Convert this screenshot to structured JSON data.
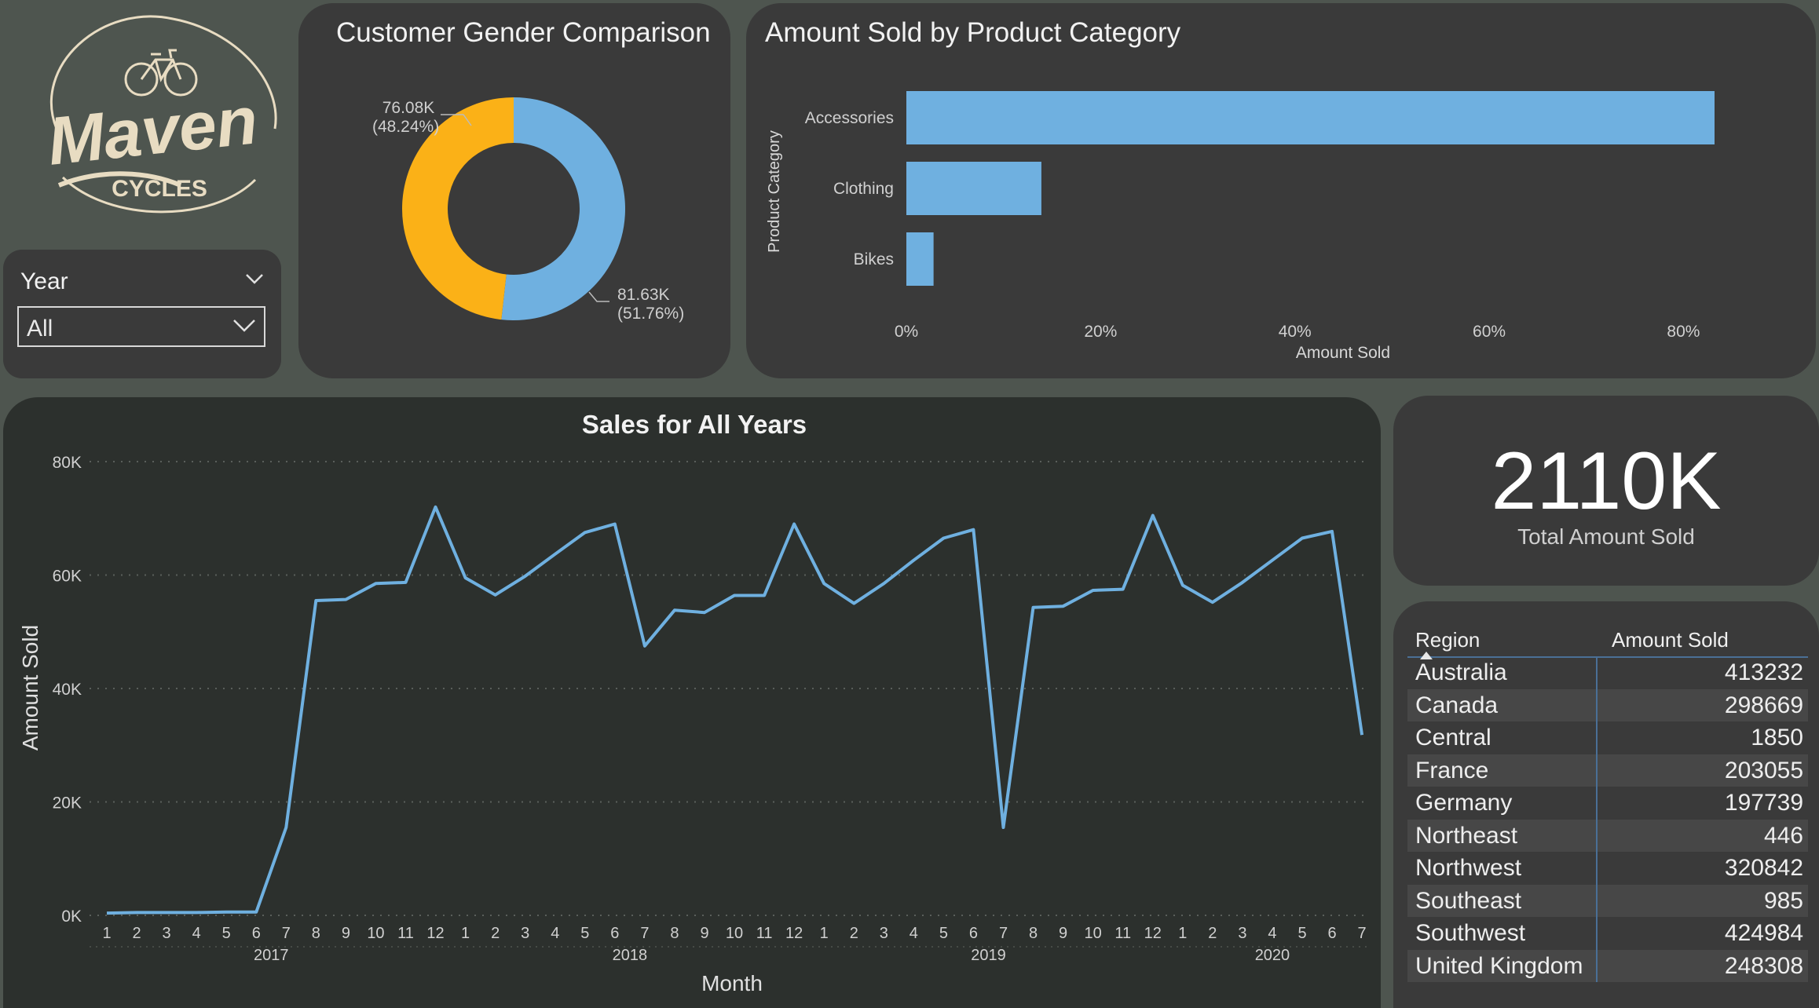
{
  "logo": {
    "text_main": "Maven",
    "text_sub": "CYCLES"
  },
  "slicer": {
    "label": "Year",
    "value": "All"
  },
  "kpi": {
    "value": "2110K",
    "label": "Total Amount Sold"
  },
  "table": {
    "headers": [
      "Region",
      "Amount Sold"
    ],
    "rows": [
      [
        "Australia",
        "413232"
      ],
      [
        "Canada",
        "298669"
      ],
      [
        "Central",
        "1850"
      ],
      [
        "France",
        "203055"
      ],
      [
        "Germany",
        "197739"
      ],
      [
        "Northeast",
        "446"
      ],
      [
        "Northwest",
        "320842"
      ],
      [
        "Southeast",
        "985"
      ],
      [
        "Southwest",
        "424984"
      ],
      [
        "United Kingdom",
        "248308"
      ]
    ]
  },
  "colors": {
    "background": "#4e554f",
    "card": "#3a3a3a",
    "line_card": "#2c302d",
    "blue": "#6fb0e0",
    "orange": "#fbb117",
    "logo": "#e8dcc2"
  },
  "chart_data": [
    {
      "type": "pie",
      "title": "Customer Gender Comparison",
      "slices": [
        {
          "value": 81.63,
          "label": "81.63K",
          "pct": "(51.76%)",
          "color": "#6fb0e0"
        },
        {
          "value": 76.08,
          "label": "76.08K",
          "pct": "(48.24%)",
          "color": "#fbb117"
        }
      ]
    },
    {
      "type": "bar",
      "orientation": "horizontal",
      "title": "Amount Sold by Product Category",
      "categories": [
        "Accessories",
        "Clothing",
        "Bikes"
      ],
      "values": [
        83.2,
        13.9,
        2.8
      ],
      "xlabel": "Amount Sold",
      "ylabel": "Product Category",
      "xticks": [
        "0%",
        "20%",
        "40%",
        "60%",
        "80%"
      ],
      "xlim": [
        0,
        83.2
      ]
    },
    {
      "type": "line",
      "title": "Sales for All Years",
      "xlabel": "Month",
      "ylabel": "Amount Sold",
      "ylim": [
        0,
        80000
      ],
      "yticks": [
        "0K",
        "20K",
        "40K",
        "60K",
        "80K"
      ],
      "x_groups": [
        {
          "year": "2017",
          "months": [
            "1",
            "2",
            "3",
            "4",
            "5",
            "6",
            "7",
            "8",
            "9",
            "10",
            "11",
            "12"
          ]
        },
        {
          "year": "2018",
          "months": [
            "1",
            "2",
            "3",
            "4",
            "5",
            "6",
            "7",
            "8",
            "9",
            "10",
            "11",
            "12"
          ]
        },
        {
          "year": "2019",
          "months": [
            "1",
            "2",
            "3",
            "4",
            "5",
            "6",
            "7",
            "8",
            "9",
            "10",
            "11",
            "12"
          ]
        },
        {
          "year": "2020",
          "months": [
            "1",
            "2",
            "3",
            "4",
            "5",
            "6",
            "7"
          ]
        }
      ],
      "values": [
        400,
        500,
        500,
        500,
        600,
        600,
        15500,
        55500,
        55700,
        58500,
        58700,
        72000,
        59500,
        56500,
        59800,
        63700,
        67500,
        69000,
        47500,
        53800,
        53400,
        56400,
        56400,
        69000,
        58500,
        55000,
        58500,
        62600,
        66500,
        68000,
        15500,
        54300,
        54500,
        57300,
        57500,
        70500,
        58200,
        55200,
        58700,
        62600,
        66500,
        67700,
        31800
      ]
    }
  ]
}
